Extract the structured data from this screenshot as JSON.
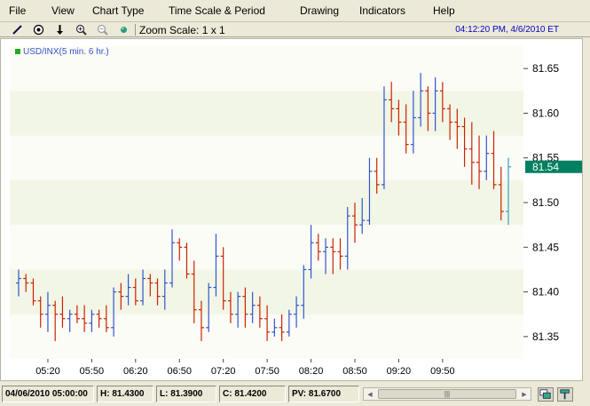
{
  "menu": {
    "items": [
      "File",
      "View",
      "Chart Type",
      "Time Scale & Period",
      "Drawing",
      "Indicators",
      "Help"
    ]
  },
  "toolbar": {
    "tools": [
      "line-draw-icon",
      "crosshair-icon",
      "arrow-down-icon",
      "zoom-in-icon",
      "zoom-out-icon",
      "refresh-icon"
    ],
    "zoom_label": "Zoom Scale: 1 x 1",
    "clock": "04:12:20 PM, 4/6/2010 ET"
  },
  "chart_data": {
    "type": "ohlc",
    "legend": "USD/INX(5 min. 6 hr.)",
    "ylim": [
      81.325,
      81.675
    ],
    "yticks": [
      "81.35",
      "81.40",
      "81.45",
      "81.50",
      "81.55",
      "81.60",
      "81.65"
    ],
    "xticks": [
      "05:20",
      "05:50",
      "06:20",
      "06:50",
      "07:20",
      "07:50",
      "08:20",
      "08:50",
      "09:20",
      "09:50"
    ],
    "last_price": "81.54",
    "colors": {
      "up": "#3355cc",
      "down": "#cc2200",
      "last": "#008060",
      "band": "#f2f6e6",
      "band_alt": "#fbfcf6"
    },
    "bars": [
      [
        81.41,
        81.425,
        81.395,
        81.415
      ],
      [
        81.415,
        81.42,
        81.4,
        81.41
      ],
      [
        81.41,
        81.415,
        81.385,
        81.39
      ],
      [
        81.39,
        81.395,
        81.36,
        81.375
      ],
      [
        81.375,
        81.4,
        81.355,
        81.385
      ],
      [
        81.385,
        81.39,
        81.345,
        81.375
      ],
      [
        81.375,
        81.395,
        81.36,
        81.37
      ],
      [
        81.37,
        81.38,
        81.355,
        81.375
      ],
      [
        81.375,
        81.385,
        81.365,
        81.37
      ],
      [
        81.37,
        81.385,
        81.355,
        81.365
      ],
      [
        81.365,
        81.38,
        81.355,
        81.375
      ],
      [
        81.375,
        81.38,
        81.36,
        81.37
      ],
      [
        81.37,
        81.385,
        81.355,
        81.36
      ],
      [
        81.36,
        81.405,
        81.35,
        81.4
      ],
      [
        81.4,
        81.41,
        81.38,
        81.395
      ],
      [
        81.395,
        81.42,
        81.385,
        81.405
      ],
      [
        81.405,
        81.415,
        81.385,
        81.39
      ],
      [
        81.39,
        81.425,
        81.385,
        81.415
      ],
      [
        81.415,
        81.42,
        81.395,
        81.41
      ],
      [
        81.41,
        81.415,
        81.385,
        81.395
      ],
      [
        81.395,
        81.425,
        81.38,
        81.41
      ],
      [
        81.41,
        81.47,
        81.405,
        81.455
      ],
      [
        81.455,
        81.46,
        81.435,
        81.45
      ],
      [
        81.45,
        81.455,
        81.415,
        81.42
      ],
      [
        81.42,
        81.435,
        81.365,
        81.38
      ],
      [
        81.38,
        81.39,
        81.345,
        81.36
      ],
      [
        81.36,
        81.41,
        81.355,
        81.405
      ],
      [
        81.405,
        81.465,
        81.395,
        81.44
      ],
      [
        81.44,
        81.45,
        81.38,
        81.39
      ],
      [
        81.39,
        81.4,
        81.365,
        81.375
      ],
      [
        81.375,
        81.4,
        81.36,
        81.395
      ],
      [
        81.395,
        81.405,
        81.36,
        81.375
      ],
      [
        81.375,
        81.4,
        81.365,
        81.385
      ],
      [
        81.385,
        81.395,
        81.36,
        81.37
      ],
      [
        81.37,
        81.385,
        81.345,
        81.355
      ],
      [
        81.355,
        81.37,
        81.35,
        81.36
      ],
      [
        81.36,
        81.375,
        81.345,
        81.355
      ],
      [
        81.355,
        81.38,
        81.35,
        81.375
      ],
      [
        81.375,
        81.395,
        81.36,
        81.385
      ],
      [
        81.385,
        81.43,
        81.37,
        81.425
      ],
      [
        81.425,
        81.475,
        81.415,
        81.455
      ],
      [
        81.455,
        81.465,
        81.435,
        81.445
      ],
      [
        81.445,
        81.46,
        81.42,
        81.45
      ],
      [
        81.45,
        81.46,
        81.42,
        81.445
      ],
      [
        81.445,
        81.46,
        81.425,
        81.44
      ],
      [
        81.44,
        81.495,
        81.425,
        81.485
      ],
      [
        81.485,
        81.5,
        81.455,
        81.475
      ],
      [
        81.475,
        81.505,
        81.465,
        81.48
      ],
      [
        81.48,
        81.55,
        81.475,
        81.535
      ],
      [
        81.535,
        81.55,
        81.51,
        81.52
      ],
      [
        81.52,
        81.63,
        81.515,
        81.615
      ],
      [
        81.615,
        81.635,
        81.59,
        81.605
      ],
      [
        81.605,
        81.615,
        81.575,
        81.59
      ],
      [
        81.59,
        81.61,
        81.555,
        81.565
      ],
      [
        81.565,
        81.625,
        81.555,
        81.595
      ],
      [
        81.595,
        81.645,
        81.585,
        81.625
      ],
      [
        81.625,
        81.63,
        81.58,
        81.6
      ],
      [
        81.6,
        81.64,
        81.58,
        81.625
      ],
      [
        81.625,
        81.635,
        81.59,
        81.605
      ],
      [
        81.605,
        81.61,
        81.57,
        81.59
      ],
      [
        81.59,
        81.605,
        81.56,
        81.585
      ],
      [
        81.585,
        81.595,
        81.54,
        81.56
      ],
      [
        81.56,
        81.59,
        81.52,
        81.545
      ],
      [
        81.545,
        81.575,
        81.515,
        81.535
      ],
      [
        81.535,
        81.575,
        81.525,
        81.555
      ],
      [
        81.555,
        81.58,
        81.515,
        81.52
      ],
      [
        81.52,
        81.54,
        81.48,
        81.49
      ],
      [
        81.49,
        81.55,
        81.475,
        81.54
      ]
    ]
  },
  "status": {
    "date": "04/06/2010 05:00:00",
    "high": "H: 81.4300",
    "low": "L: 81.3900",
    "close": "C: 81.4200",
    "pv": "PV: 81.6700"
  }
}
